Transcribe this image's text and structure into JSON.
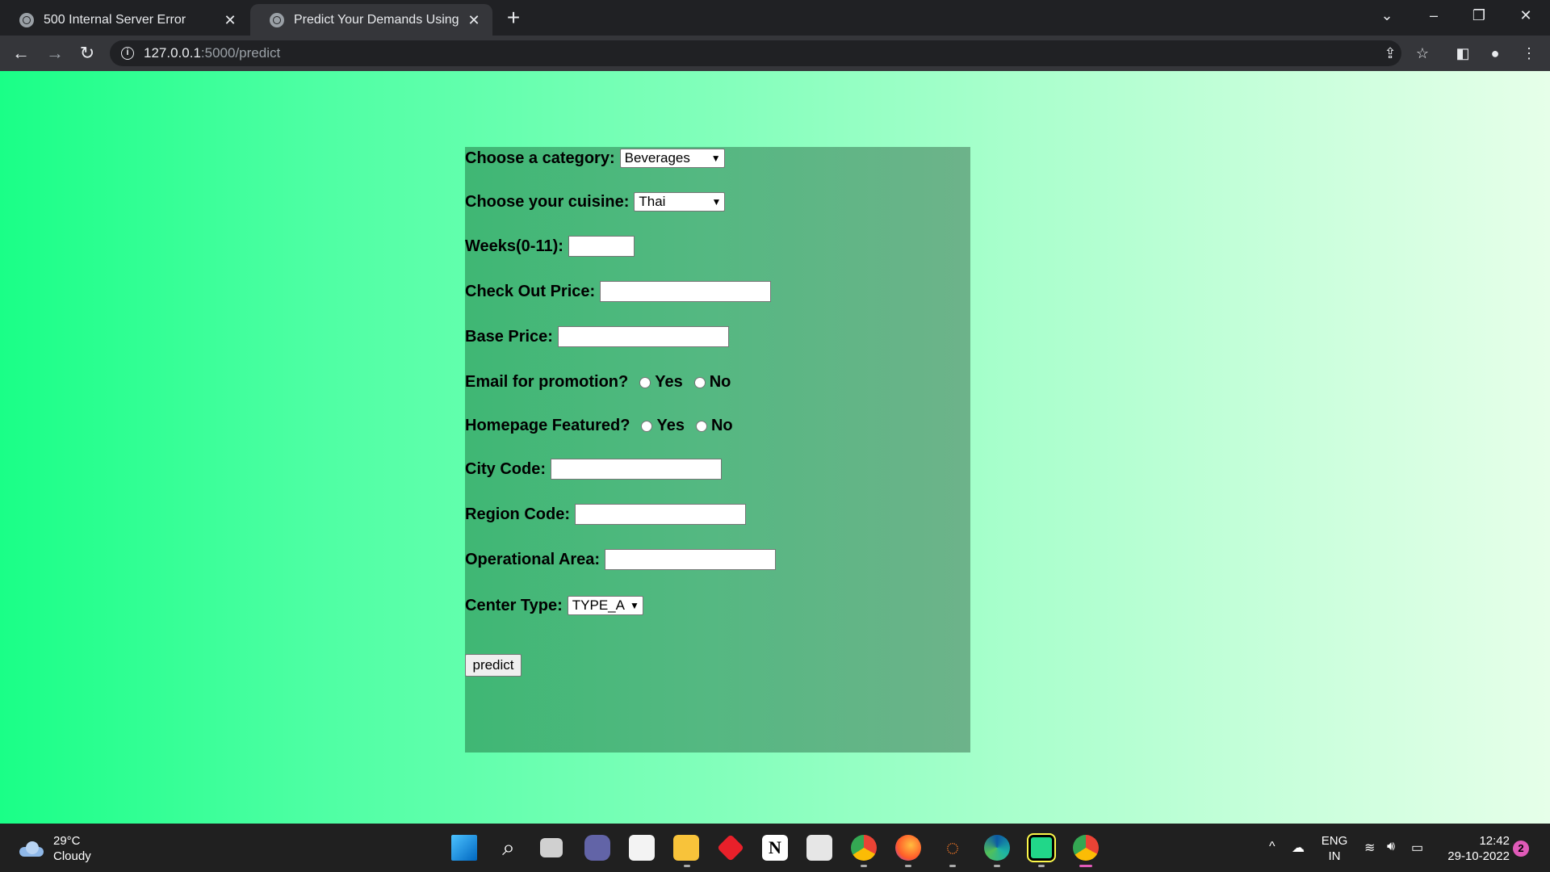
{
  "browser": {
    "tabs": [
      {
        "title": "500 Internal Server Error",
        "active": false
      },
      {
        "title": "Predict Your Demands Using Our",
        "active": true
      }
    ],
    "url_host": "127.0.0.1",
    "url_path": ":5000/predict"
  },
  "form": {
    "category": {
      "label": "Choose a category:",
      "value": "Beverages"
    },
    "cuisine": {
      "label": "Choose your cuisine:",
      "value": "Thai"
    },
    "weeks": {
      "label": "Weeks(0-11):",
      "value": ""
    },
    "checkout_price": {
      "label": "Check Out Price:",
      "value": ""
    },
    "base_price": {
      "label": "Base Price:",
      "value": ""
    },
    "email_promotion": {
      "label": "Email for promotion?",
      "yes": "Yes",
      "no": "No"
    },
    "homepage_featured": {
      "label": "Homepage Featured?",
      "yes": "Yes",
      "no": "No"
    },
    "city_code": {
      "label": "City Code:",
      "value": ""
    },
    "region_code": {
      "label": "Region Code:",
      "value": ""
    },
    "operational_area": {
      "label": "Operational Area:",
      "value": ""
    },
    "center_type": {
      "label": "Center Type:",
      "value": "TYPE_A"
    },
    "predict_label": "predict"
  },
  "taskbar": {
    "temperature": "29°C",
    "weather": "Cloudy",
    "lang_top": "ENG",
    "lang_bottom": "IN",
    "time": "12:42",
    "date": "29-10-2022",
    "notifications": "2"
  }
}
